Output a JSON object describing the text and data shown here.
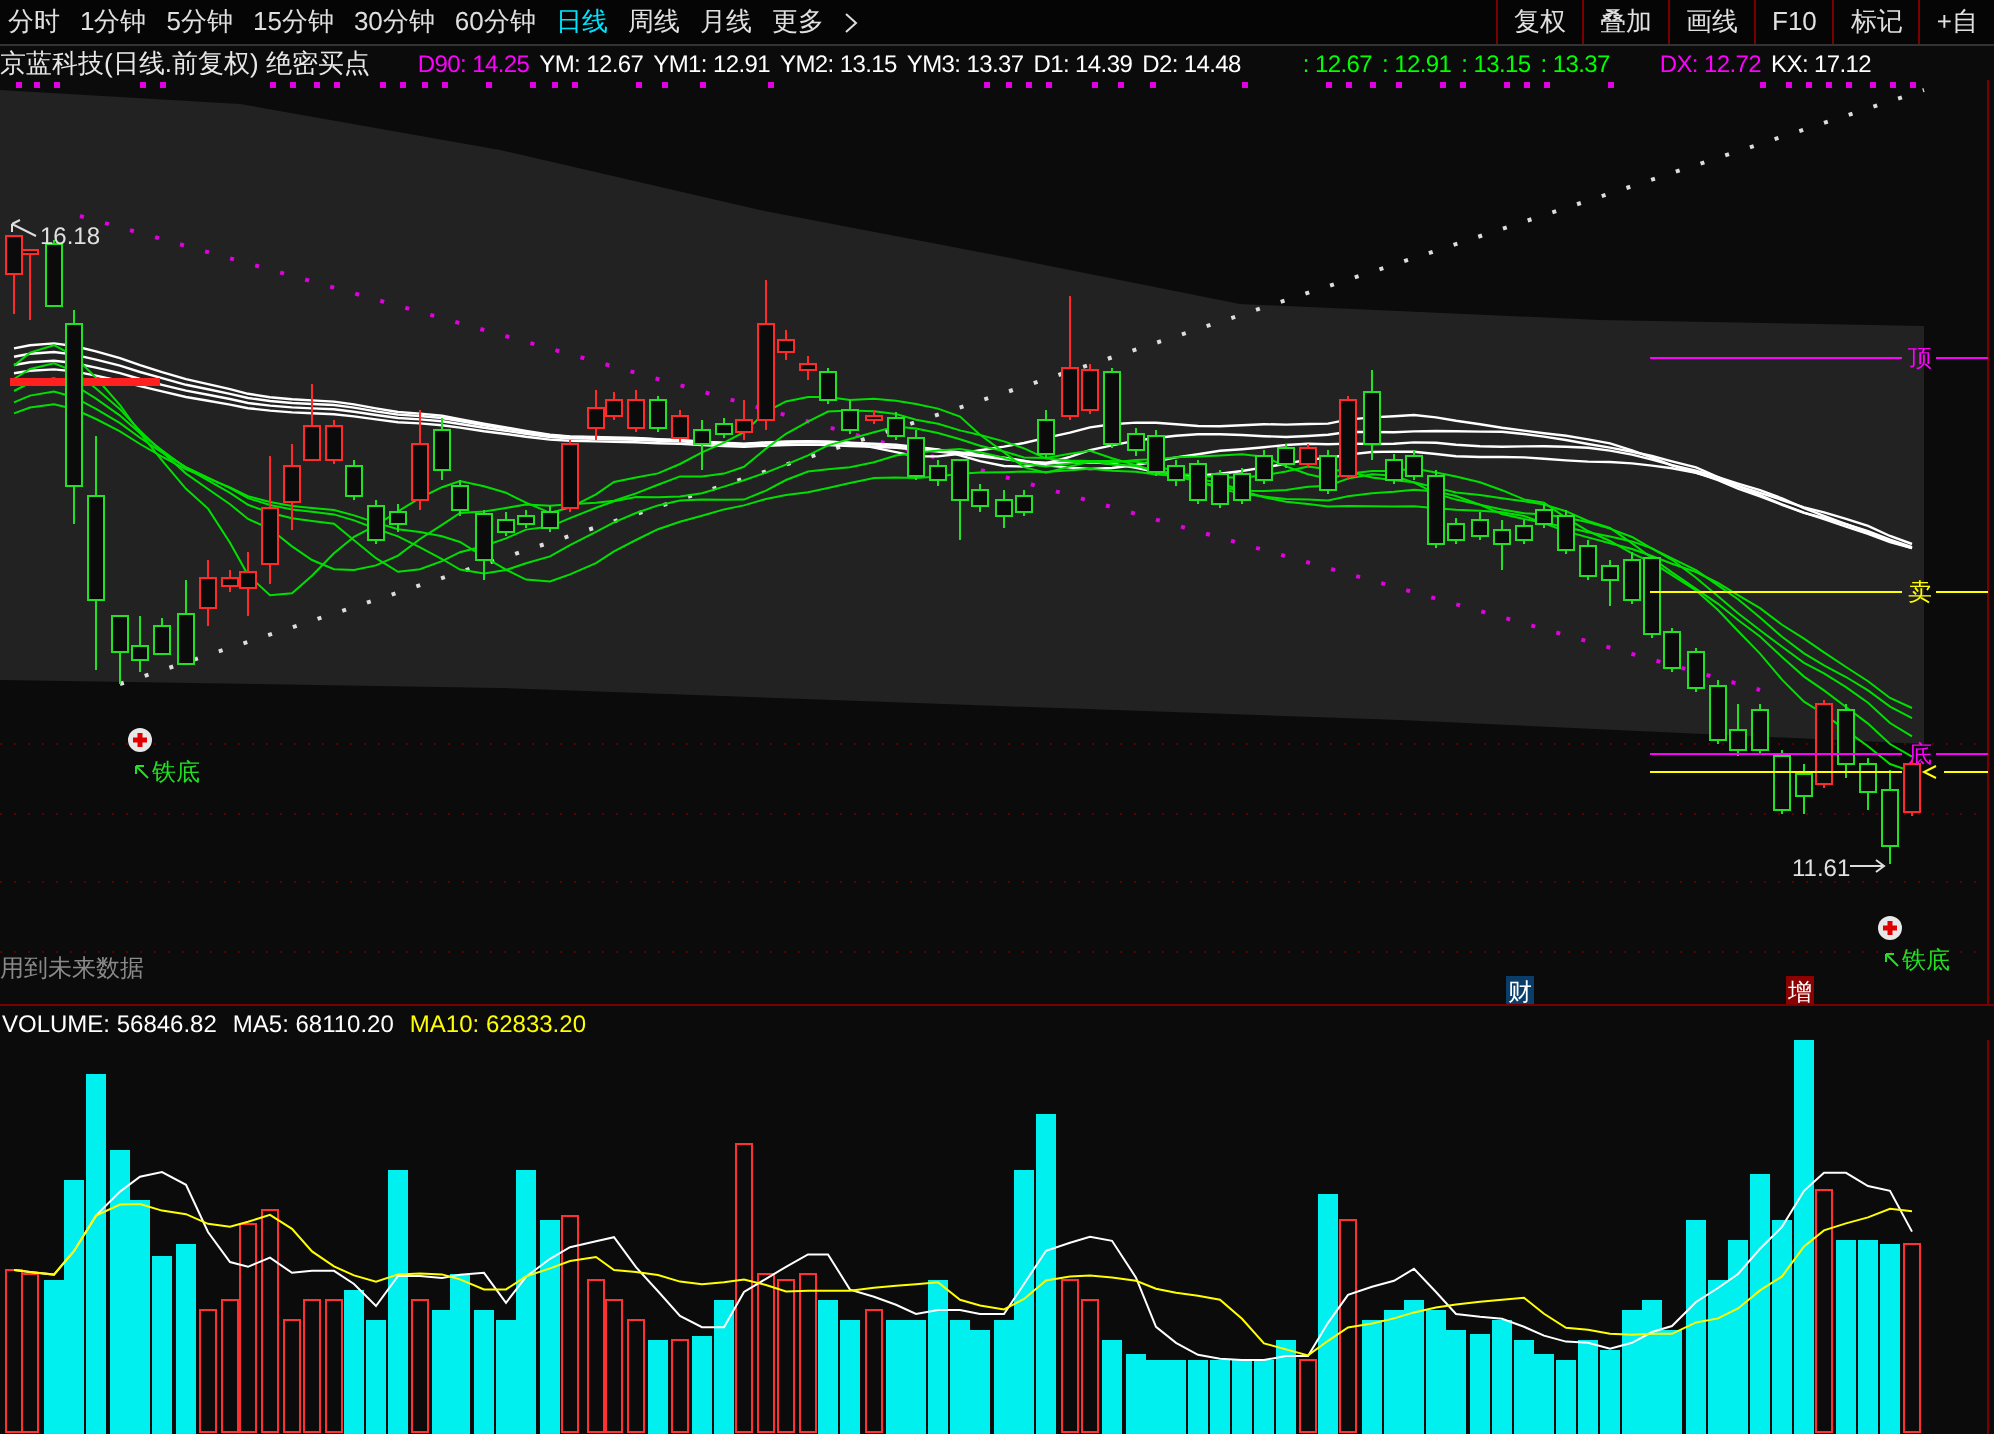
{
  "periods": [
    {
      "label": "分时",
      "selected": false
    },
    {
      "label": "1分钟",
      "selected": false
    },
    {
      "label": "5分钟",
      "selected": false
    },
    {
      "label": "15分钟",
      "selected": false
    },
    {
      "label": "30分钟",
      "selected": false
    },
    {
      "label": "60分钟",
      "selected": false
    },
    {
      "label": "日线",
      "selected": true
    },
    {
      "label": "周线",
      "selected": false
    },
    {
      "label": "月线",
      "selected": false
    },
    {
      "label": "更多",
      "selected": false
    }
  ],
  "tools": [
    "复权",
    "叠加",
    "画线",
    "F10",
    "标记",
    "+自"
  ],
  "info": {
    "title": "京蓝科技(日线.前复权) 绝密买点",
    "values": [
      {
        "text": "D90: 14.25",
        "color": "#ff00ff"
      },
      {
        "text": "YM: 12.67",
        "color": "#ffffff"
      },
      {
        "text": "YM1: 12.91",
        "color": "#ffffff"
      },
      {
        "text": "YM2: 13.15",
        "color": "#ffffff"
      },
      {
        "text": "YM3: 13.37",
        "color": "#ffffff"
      },
      {
        "text": "D1: 14.39",
        "color": "#ffffff"
      },
      {
        "text": "D2: 14.48",
        "color": "#ffffff"
      },
      {
        "text": ": 12.67",
        "color": "#00ff00"
      },
      {
        "text": ": 12.91",
        "color": "#00ff00"
      },
      {
        "text": ": 13.15",
        "color": "#00ff00"
      },
      {
        "text": ": 13.37",
        "color": "#00ff00"
      },
      {
        "text": "DX: 12.72",
        "color": "#ff00ff"
      },
      {
        "text": "KX: 17.12",
        "color": "#ffffff"
      }
    ]
  },
  "price_chart": {
    "high_label": "16.18",
    "low_label": "11.61",
    "level_tags": [
      {
        "text": "顶",
        "color": "#ff00ff"
      },
      {
        "text": "卖",
        "color": "#ffff00"
      },
      {
        "text": "底",
        "color": "#ff00ff"
      }
    ],
    "signals": [
      {
        "text": "铁底"
      },
      {
        "text": "铁底"
      }
    ],
    "note": "用到未来数据",
    "badges": [
      {
        "text": "财",
        "color": "#0b3d6b"
      },
      {
        "text": "增",
        "color": "#8b0000"
      }
    ]
  },
  "volume": {
    "values": [
      {
        "text": "VOLUME: 56846.82",
        "color": "#ffffff"
      },
      {
        "text": "MA5: 68110.20",
        "color": "#ffffff"
      },
      {
        "text": "MA10: 62833.20",
        "color": "#ffff00"
      }
    ]
  }
}
